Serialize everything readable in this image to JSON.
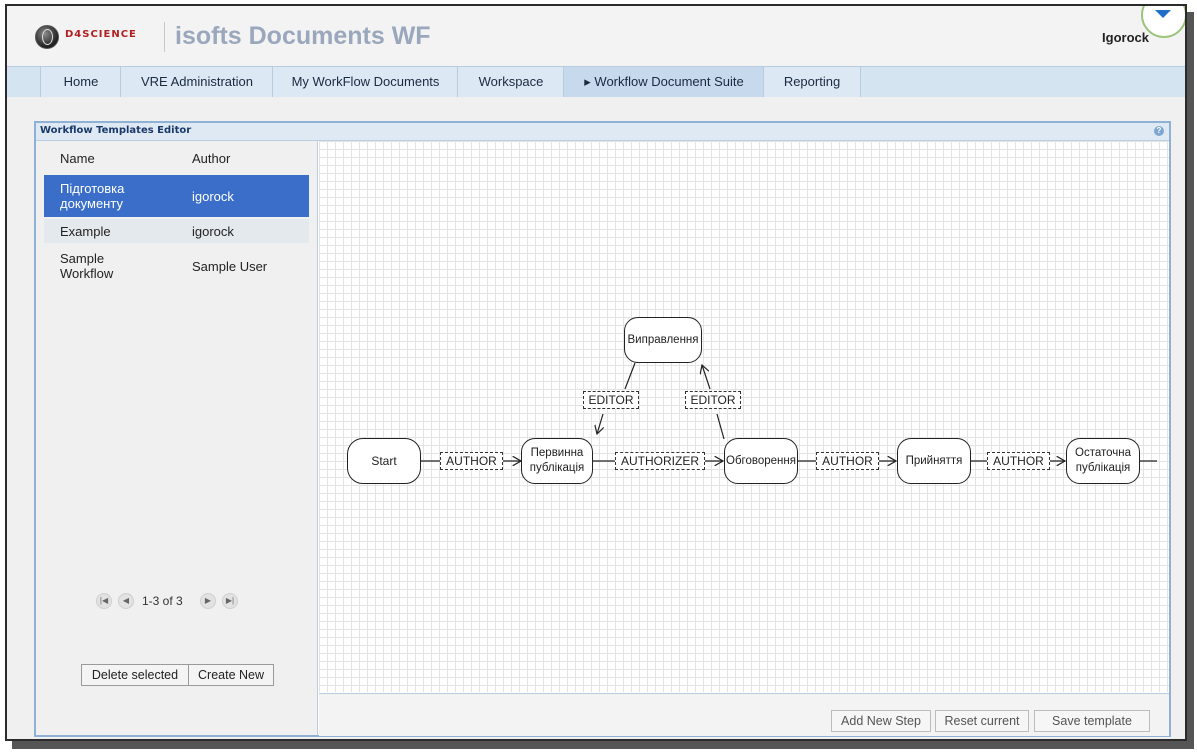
{
  "header": {
    "logo_text": "D4SCIENCE",
    "app_title": "isofts Documents WF",
    "username": "Igorock"
  },
  "nav": {
    "tabs": [
      {
        "label": "Home"
      },
      {
        "label": "VRE Administration"
      },
      {
        "label": "My WorkFlow Documents"
      },
      {
        "label": "Workspace"
      },
      {
        "label": "▸ Workflow Document Suite",
        "active": true
      },
      {
        "label": "Reporting"
      }
    ]
  },
  "panel": {
    "title": "Workflow Templates Editor",
    "help_icon": "help-icon"
  },
  "templates": {
    "columns": [
      "Name",
      "Author"
    ],
    "rows": [
      {
        "name": "Підготовка документу",
        "author": "igorock",
        "selected": true
      },
      {
        "name": "Example",
        "author": "igorock"
      },
      {
        "name": "Sample Workflow",
        "author": "Sample User"
      }
    ],
    "pager": "1-3 of 3",
    "delete_label": "Delete selected",
    "create_label": "Create New"
  },
  "workflow": {
    "nodes": [
      "Start",
      "Первинна публікація",
      "Виправлення",
      "Обговорення",
      "Прийняття",
      "Остаточна публікація"
    ],
    "roles": [
      "AUTHOR",
      "EDITOR",
      "EDITOR",
      "AUTHORIZER",
      "AUTHOR",
      "AUTHOR"
    ]
  },
  "actions": {
    "add_step": "Add New Step",
    "reset": "Reset current",
    "save": "Save template"
  },
  "colors": {
    "accent": "#3b6ec8",
    "nav_bg": "#d5e4f1",
    "panel_border": "#8fb1d6"
  }
}
